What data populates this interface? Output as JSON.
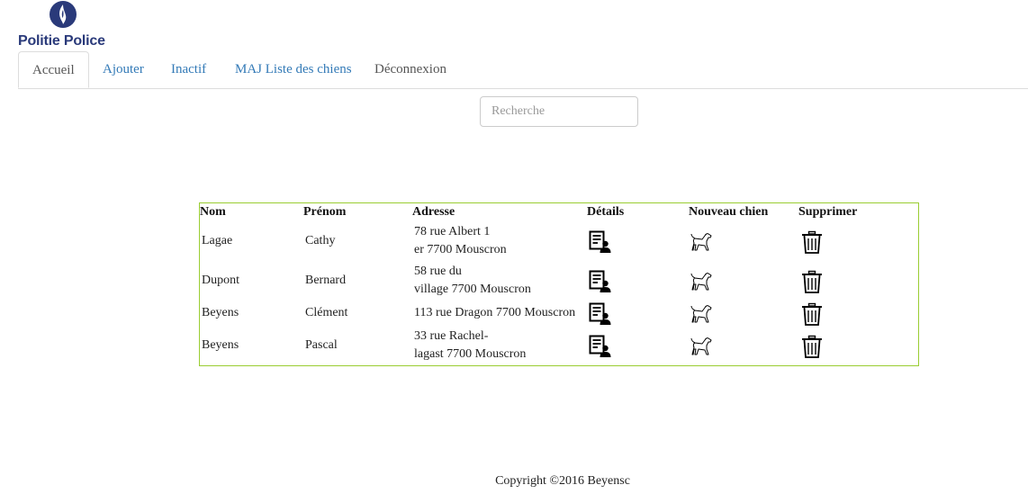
{
  "brand": {
    "name": "Politie Police",
    "color": "#2a3a7a"
  },
  "nav": {
    "tabs": [
      {
        "label": "Accueil",
        "active": true
      },
      {
        "label": "Ajouter"
      },
      {
        "label": "Inactif"
      },
      {
        "label": "MAJ Liste des chiens"
      },
      {
        "label": "Déconnexion"
      }
    ]
  },
  "search": {
    "placeholder": "Recherche",
    "value": ""
  },
  "table": {
    "border_color": "#9acd32",
    "headers": [
      "Nom",
      "Prénom",
      "Adresse",
      "Détails",
      "Nouveau chien",
      "Supprimer"
    ],
    "icons": {
      "details": "person-document-icon",
      "new_dog": "dog-icon",
      "delete": "trash-icon"
    },
    "rows": [
      {
        "nom": "Lagae",
        "prenom": "Cathy",
        "adresse": "78  rue  Albert 1\ner 7700 Mouscron"
      },
      {
        "nom": "Dupont",
        "prenom": "Bernard",
        "adresse": "58  rue   du\nvillage 7700 Mouscron"
      },
      {
        "nom": "Beyens",
        "prenom": "Clément",
        "adresse": "113  rue  Dragon 7700 Mouscron"
      },
      {
        "nom": "Beyens",
        "prenom": "Pascal",
        "adresse": "33  rue  Rachel-\nlagast 7700 Mouscron"
      }
    ]
  },
  "footer": {
    "text": "Copyright ©2016 Beyensc"
  }
}
